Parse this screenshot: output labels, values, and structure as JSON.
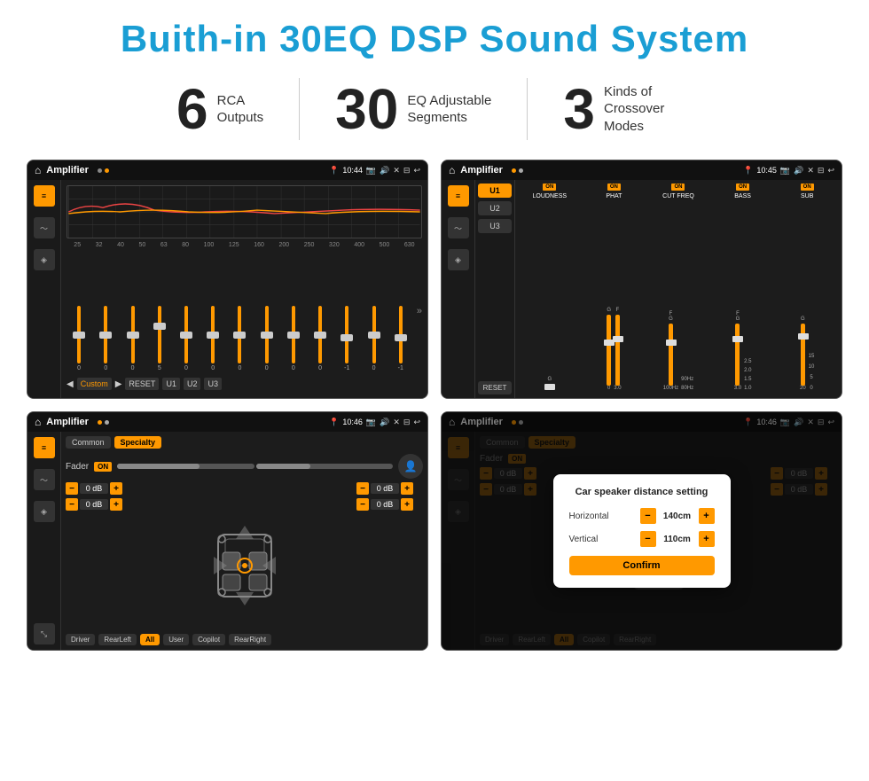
{
  "page": {
    "title": "Buith-in 30EQ DSP Sound System",
    "stats": [
      {
        "number": "6",
        "label": "RCA\nOutputs"
      },
      {
        "number": "30",
        "label": "EQ Adjustable\nSegments"
      },
      {
        "number": "3",
        "label": "Kinds of\nCrossover Modes"
      }
    ],
    "screenshots": [
      {
        "id": "eq-main",
        "status": {
          "app": "Amplifier",
          "time": "10:44"
        },
        "type": "equalizer"
      },
      {
        "id": "crossover",
        "status": {
          "app": "Amplifier",
          "time": "10:45"
        },
        "type": "crossover"
      },
      {
        "id": "fader",
        "status": {
          "app": "Amplifier",
          "time": "10:46"
        },
        "type": "fader"
      },
      {
        "id": "dialog",
        "status": {
          "app": "Amplifier",
          "time": "10:46"
        },
        "type": "dialog",
        "dialog": {
          "title": "Car speaker distance setting",
          "horizontal": {
            "label": "Horizontal",
            "value": "140cm"
          },
          "vertical": {
            "label": "Vertical",
            "value": "110cm"
          },
          "confirm": "Confirm"
        }
      }
    ],
    "eq": {
      "frequencies": [
        "25",
        "32",
        "40",
        "50",
        "63",
        "80",
        "100",
        "125",
        "160",
        "200",
        "250",
        "320",
        "400",
        "500",
        "630"
      ],
      "values": [
        "0",
        "0",
        "0",
        "5",
        "0",
        "0",
        "0",
        "0",
        "0",
        "0",
        "-1",
        "0",
        "-1"
      ],
      "presets": [
        "Custom",
        "RESET",
        "U1",
        "U2",
        "U3"
      ]
    },
    "crossover": {
      "channels": [
        {
          "id": "U1",
          "label": "U1"
        },
        {
          "id": "U2",
          "label": "U2"
        },
        {
          "id": "U3",
          "label": "U3"
        }
      ],
      "params": [
        "LOUDNESS",
        "PHAT",
        "CUT FREQ",
        "BASS",
        "SUB"
      ],
      "reset": "RESET"
    },
    "fader": {
      "tabs": [
        "Common",
        "Specialty"
      ],
      "faderLabel": "Fader",
      "onLabel": "ON",
      "volumes": [
        "0 dB",
        "0 dB",
        "0 dB",
        "0 dB"
      ],
      "bottomBtns": [
        "Driver",
        "RearLeft",
        "All",
        "User",
        "Copilot",
        "RearRight"
      ]
    },
    "dialog": {
      "title": "Car speaker distance setting",
      "horizontal_label": "Horizontal",
      "horizontal_value": "140cm",
      "vertical_label": "Vertical",
      "vertical_value": "110cm",
      "confirm_label": "Confirm"
    }
  }
}
